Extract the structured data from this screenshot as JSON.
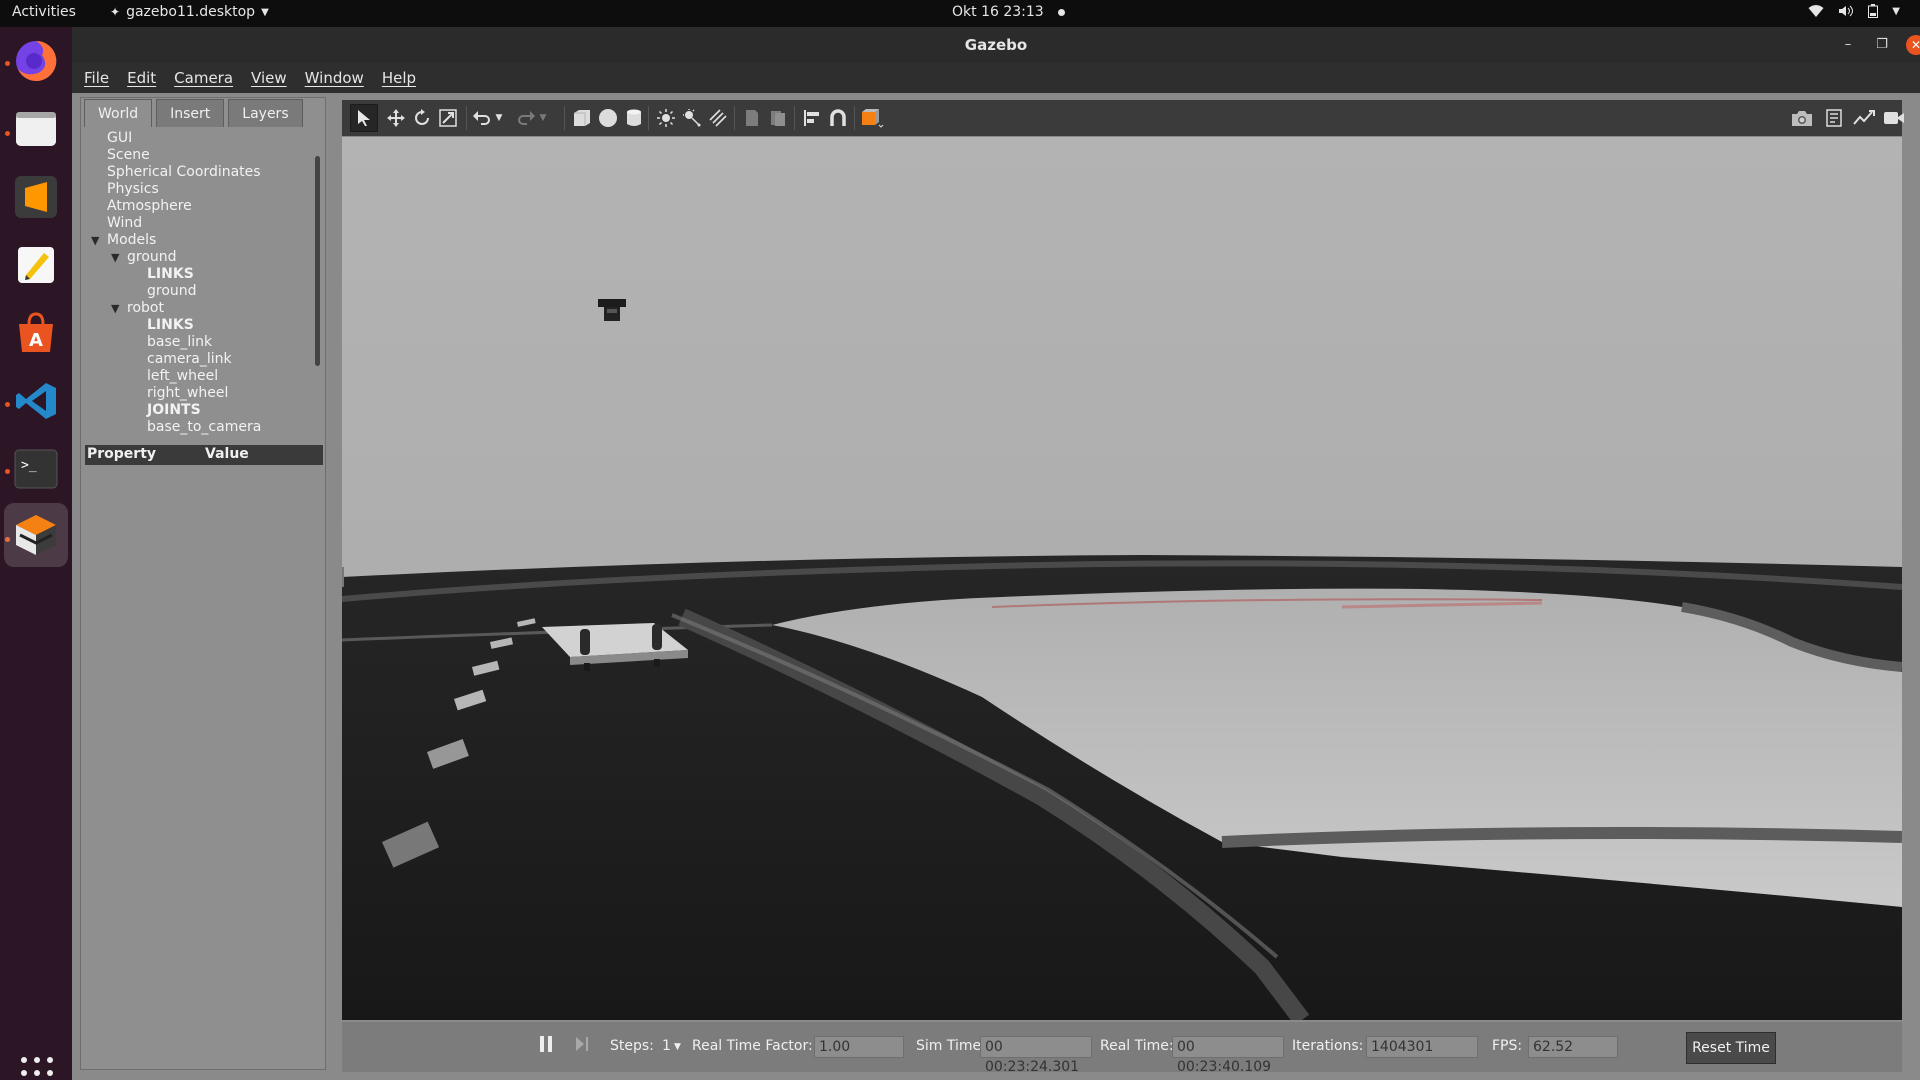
{
  "topbar": {
    "activities": "Activities",
    "app_name": "gazebo11.desktop",
    "clock": "Okt 16  23:13"
  },
  "window": {
    "title": "Gazebo"
  },
  "menu": [
    "File",
    "Edit",
    "Camera",
    "View",
    "Window",
    "Help"
  ],
  "left_panel": {
    "tabs": [
      "World",
      "Insert",
      "Layers"
    ],
    "selected_tab": "World",
    "tree": [
      {
        "label": "GUI"
      },
      {
        "label": "Scene"
      },
      {
        "label": "Spherical Coordinates"
      },
      {
        "label": "Physics"
      },
      {
        "label": "Atmosphere"
      },
      {
        "label": "Wind"
      },
      {
        "label": "Models"
      },
      {
        "label": "ground"
      },
      {
        "label": "LINKS"
      },
      {
        "label": "ground"
      },
      {
        "label": "robot"
      },
      {
        "label": "LINKS"
      },
      {
        "label": "base_link"
      },
      {
        "label": "camera_link"
      },
      {
        "label": "left_wheel"
      },
      {
        "label": "right_wheel"
      },
      {
        "label": "JOINTS"
      },
      {
        "label": "base_to_camera"
      }
    ],
    "property_header": {
      "property": "Property",
      "value": "Value"
    }
  },
  "toolbar": {
    "tools": [
      "select-icon",
      "translate-icon",
      "rotate-icon",
      "scale-icon",
      "undo-icon",
      "redo-icon",
      "box-icon",
      "sphere-icon",
      "cylinder-icon",
      "point-light-icon",
      "spot-light-icon",
      "directional-light-icon",
      "copy-icon",
      "paste-icon",
      "align-icon",
      "snap-icon",
      "view-angle-icon",
      "screenshot-icon",
      "log-icon",
      "plot-icon",
      "video-icon"
    ]
  },
  "bottom": {
    "steps_label": "Steps:",
    "steps_value": "1",
    "rtf_label": "Real Time Factor:",
    "rtf_value": "1.00",
    "sim_label": "Sim Time:",
    "sim_value": "00 00:23:24.301",
    "real_label": "Real Time:",
    "real_value": "00 00:23:40.109",
    "iter_label": "Iterations:",
    "iter_value": "1404301",
    "fps_label": "FPS:",
    "fps_value": "62.52",
    "reset_label": "Reset Time"
  }
}
